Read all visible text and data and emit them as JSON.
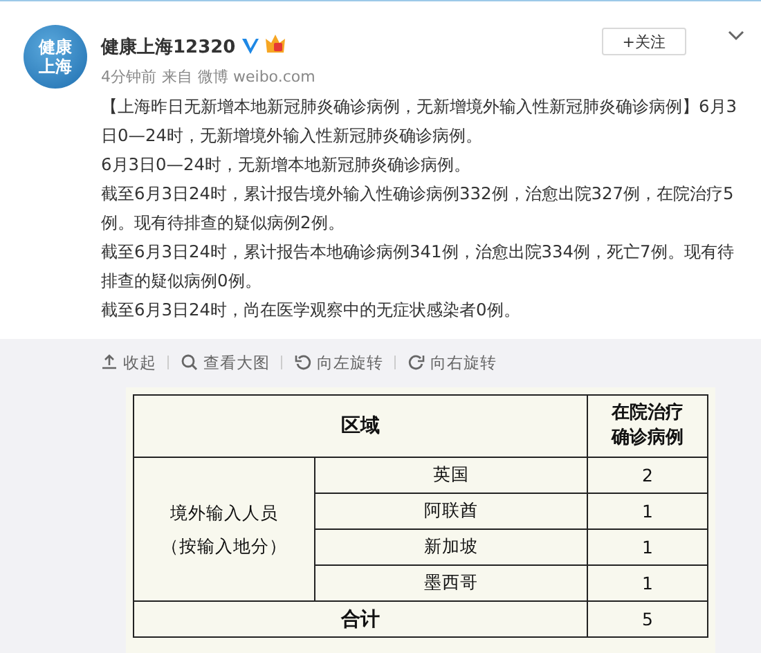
{
  "post": {
    "author": "健康上海12320",
    "avatar_text": [
      "健康",
      "上海"
    ],
    "verified": true,
    "time": "4分钟前",
    "source_prefix": "来自",
    "source": "微博 weibo.com",
    "follow_button": "+关注",
    "paragraphs": [
      "【上海昨日无新增本地新冠肺炎确诊病例，无新增境外输入性新冠肺炎确诊病例】6月3日0—24时，无新增境外输入性新冠肺炎确诊病例。",
      "6月3日0—24时，无新增本地新冠肺炎确诊病例。",
      "截至6月3日24时，累计报告境外输入性确诊病例332例，治愈出院327例，在院治疗5例。现有待排查的疑似病例2例。",
      "截至6月3日24时，累计报告本地确诊病例341例，治愈出院334例，死亡7例。现有待排查的疑似病例0例。",
      "截至6月3日24时，尚在医学观察中的无症状感染者0例。"
    ]
  },
  "image_toolbar": [
    {
      "kind": "collapse",
      "label": "收起"
    },
    {
      "kind": "zoom",
      "label": "查看大图"
    },
    {
      "kind": "rotate_left",
      "label": "向左旋转"
    },
    {
      "kind": "rotate_right",
      "label": "向右旋转"
    }
  ],
  "table": {
    "header_region": "区域",
    "header_count": [
      "在院治疗",
      "确诊病例"
    ],
    "group_label": [
      "境外输入人员",
      "（按输入地分）"
    ],
    "rows": [
      {
        "place": "英国",
        "count": "2"
      },
      {
        "place": "阿联酋",
        "count": "1"
      },
      {
        "place": "新加坡",
        "count": "1"
      },
      {
        "place": "墨西哥",
        "count": "1"
      }
    ],
    "total_label": "合计",
    "total": "5"
  }
}
